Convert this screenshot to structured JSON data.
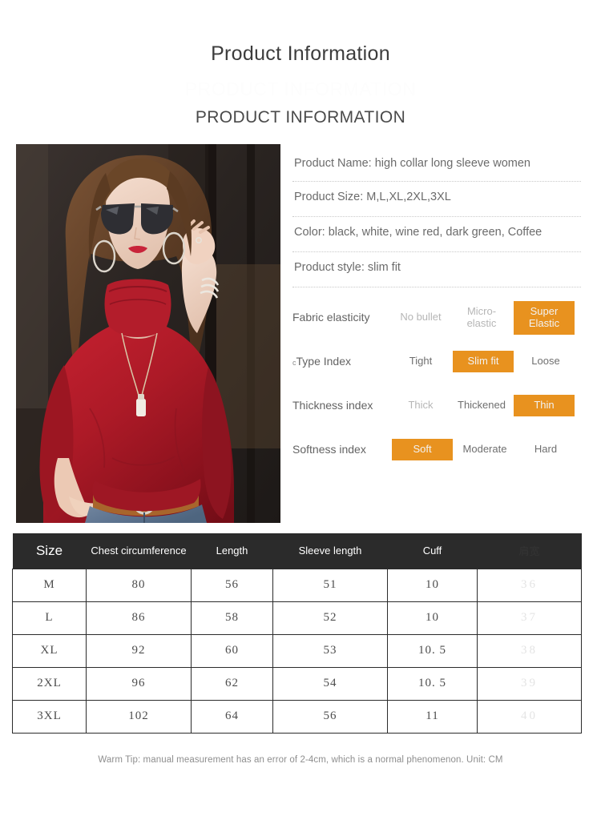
{
  "header": {
    "title": "Product Information",
    "ghost_title": "PRODUCT INFORMATION",
    "subtitle": "PRODUCT INFORMATION"
  },
  "photo": {
    "alt": "model wearing red high collar long sleeve turtleneck with sunglasses",
    "garment_color": "#A81826",
    "background_color": "#2a2522"
  },
  "specs": [
    {
      "label": "Product Name: high collar long sleeve women"
    },
    {
      "label": "Product Size: M,L,XL,2XL,3XL"
    },
    {
      "label": "Color: black, white, wine red, dark green, Coffee"
    },
    {
      "label": "Product style: slim fit"
    }
  ],
  "attributes": {
    "highlight_color": "#e8921f",
    "rows": [
      {
        "label": "Fabric elasticity",
        "lead": "",
        "options": [
          {
            "text": "No bullet",
            "selected": false,
            "tone": "light"
          },
          {
            "text": "Micro-elastic",
            "selected": false,
            "tone": "light"
          },
          {
            "text": "Super Elastic",
            "selected": true,
            "tone": "light"
          }
        ]
      },
      {
        "label": "Type Index",
        "lead": "c",
        "options": [
          {
            "text": "Tight",
            "selected": false,
            "tone": "mid"
          },
          {
            "text": "Slim fit",
            "selected": true,
            "tone": "light"
          },
          {
            "text": "Loose",
            "selected": false,
            "tone": "dark"
          }
        ]
      },
      {
        "label": "Thickness index",
        "lead": "",
        "options": [
          {
            "text": "Thick",
            "selected": false,
            "tone": "light"
          },
          {
            "text": "Thickened",
            "selected": false,
            "tone": "dark"
          },
          {
            "text": "Thin",
            "selected": true,
            "tone": "light"
          }
        ]
      },
      {
        "label": "Softness index",
        "lead": "",
        "options": [
          {
            "text": "Soft",
            "selected": true,
            "tone": "light"
          },
          {
            "text": "Moderate",
            "selected": false,
            "tone": "dark"
          },
          {
            "text": "Hard",
            "selected": false,
            "tone": "mid"
          }
        ]
      }
    ]
  },
  "size_table": {
    "headers": [
      "Size",
      "Chest circumference",
      "Length",
      "Sleeve length",
      "Cuff",
      "肩宽"
    ],
    "rows": [
      [
        "M",
        "80",
        "56",
        "51",
        "10",
        "36"
      ],
      [
        "L",
        "86",
        "58",
        "52",
        "10",
        "37"
      ],
      [
        "XL",
        "92",
        "60",
        "53",
        "10. 5",
        "38"
      ],
      [
        "2XL",
        "96",
        "62",
        "54",
        "10. 5",
        "39"
      ],
      [
        "3XL",
        "102",
        "64",
        "56",
        "11",
        "40"
      ]
    ]
  },
  "footer": {
    "warm_tip": "Warm Tip: manual measurement has an error of 2-4cm, which is a normal phenomenon. Unit: CM"
  }
}
